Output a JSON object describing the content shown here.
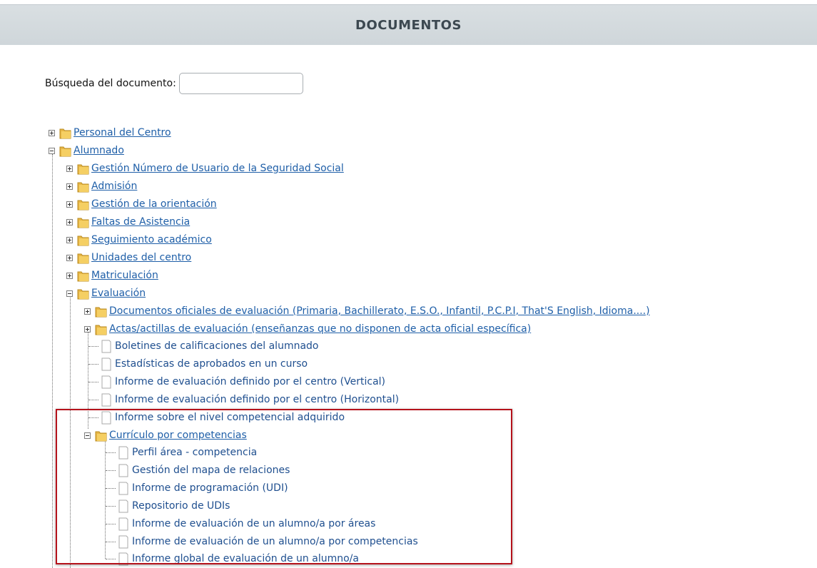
{
  "header": {
    "title": "DOCUMENTOS"
  },
  "search": {
    "label": "Búsqueda del documento:",
    "value": "",
    "placeholder": ""
  },
  "tree": {
    "personal": "Personal del Centro",
    "alumnado": "Alumnado",
    "gestion_nuss": "Gestión Número de Usuario de la Seguridad Social",
    "admision": "Admisión",
    "orientacion": "Gestión de la orientación",
    "faltas": "Faltas de Asistencia",
    "seguimiento": "Seguimiento académico",
    "unidades": "Unidades del centro",
    "matriculacion": "Matriculación",
    "evaluacion": "Evaluación",
    "docs_oficiales": "Documentos oficiales de evaluación (Primaria, Bachillerato, E.S.O., Infantil, P.C.P.I, That'S English, Idioma....)",
    "actas": "Actas/actillas de evaluación (enseñanzas que no disponen de acta oficial específica)",
    "boletines": "Boletines de calificaciones del alumnado",
    "estadisticas": "Estadísticas de aprobados en un curso",
    "informe_vertical": "Informe de evaluación definido por el centro (Vertical)",
    "informe_horizontal": "Informe de evaluación definido por el centro (Horizontal)",
    "informe_nivel": "Informe sobre el nivel competencial adquirido",
    "curriculo": "Currículo por competencias",
    "perfil": "Perfil área - competencia",
    "mapa": "Gestión del mapa de relaciones",
    "programacion": "Informe de programación (UDI)",
    "repositorio": "Repositorio de UDIs",
    "eval_areas": "Informe de evaluación de un alumno/a por áreas",
    "eval_competencias": "Informe de evaluación de un alumno/a por competencias",
    "informe_global": "Informe global de evaluación de un alumno/a"
  },
  "colors": {
    "link": "#1f5fa8",
    "header_bg": "#d4dadd",
    "highlight": "#b5121b"
  },
  "icons": {
    "folder": "folder-icon",
    "document": "document-icon",
    "expand": "expand-plus-icon",
    "collapse": "collapse-minus-icon"
  }
}
